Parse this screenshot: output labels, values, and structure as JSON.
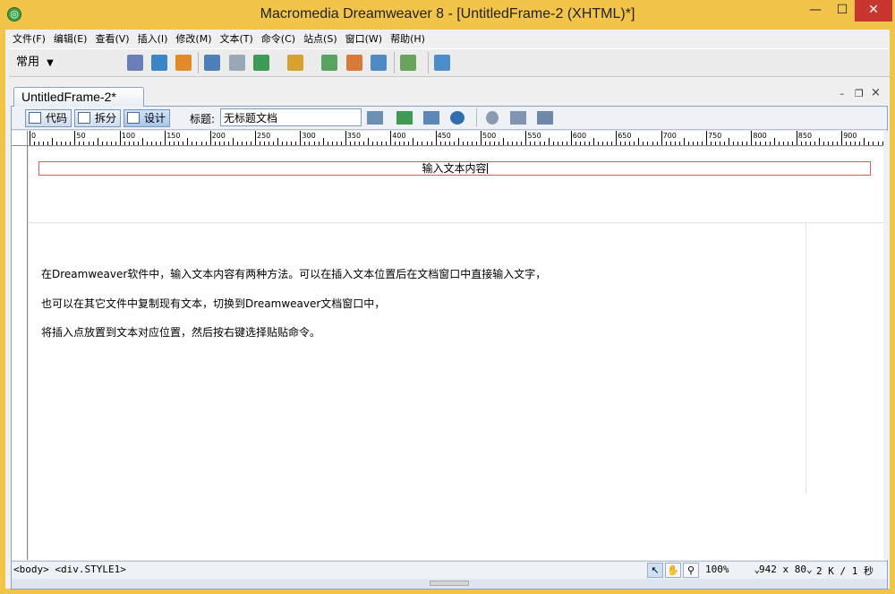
{
  "window": {
    "title": "Macromedia Dreamweaver 8 - [UntitledFrame-2 (XHTML)*]",
    "controls": {
      "minimize": "—",
      "maximize": "☐",
      "close": "✕"
    }
  },
  "menubar": [
    "文件(F)",
    "编辑(E)",
    "查看(V)",
    "插入(I)",
    "修改(M)",
    "文本(T)",
    "命令(C)",
    "站点(S)",
    "窗口(W)",
    "帮助(H)"
  ],
  "insert_bar": {
    "category": "常用",
    "category_arrow": "▼",
    "icons": [
      "hyperlink-icon",
      "email-link-icon",
      "named-anchor-icon",
      "table-icon",
      "layer-icon",
      "image-icon",
      "media-icon",
      "date-icon",
      "server-include-icon",
      "comment-icon",
      "template-icon",
      "tag-chooser-icon"
    ]
  },
  "document": {
    "tab_label": "UntitledFrame-2*",
    "controls": {
      "minimize": "–",
      "restore": "❐",
      "close": "×"
    },
    "views": {
      "code": "代码",
      "split": "拆分",
      "design": "设计"
    },
    "title_label": "标题:",
    "title_value": "无标题文档",
    "toolbar_icons": [
      "file-management-icon",
      "preview-icon",
      "debug-icon",
      "validate-icon",
      "refresh-icon",
      "view-options-icon",
      "visual-aids-icon"
    ]
  },
  "ruler": {
    "labels": [
      "0",
      "50",
      "100",
      "150",
      "200",
      "250",
      "300",
      "350",
      "400",
      "450",
      "500",
      "550",
      "600",
      "650",
      "700",
      "750",
      "800",
      "850",
      "900"
    ]
  },
  "content": {
    "div_text": "输入文本内容",
    "paragraphs": [
      "在Dreamweaver软件中，输入文本内容有两种方法。可以在插入文本位置后在文档窗口中直接输入文字，",
      "也可以在其它文件中复制现有文本，切换到Dreamweaver文档窗口中，",
      "将插入点放置到文本对应位置，然后按右键选择贴贴命令。"
    ]
  },
  "status_bar": {
    "tag_selector": "<body> <div.STYLE1>",
    "zoom": "100%",
    "window_size": "942 x 80",
    "download": "2 K / 1 秒"
  }
}
